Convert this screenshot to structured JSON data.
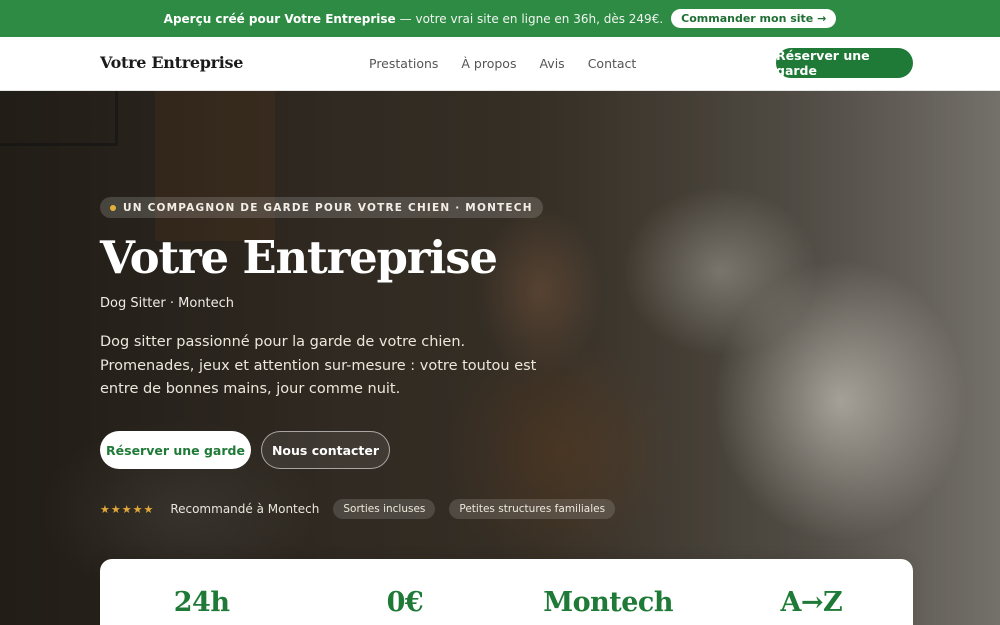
{
  "promo": {
    "lead": "Aperçu créé pour Votre Entreprise",
    "text": "— votre vrai site en ligne en 36h, dès 249€.",
    "button": "Commander mon site →"
  },
  "header": {
    "brand": "Votre Entreprise",
    "nav": [
      "Prestations",
      "À propos",
      "Avis",
      "Contact"
    ],
    "cta": "Réserver une garde"
  },
  "hero": {
    "eyebrow": "UN COMPAGNON DE GARDE POUR VOTRE CHIEN · MONTECH",
    "title": "Votre Entreprise",
    "subtitle": "Dog Sitter · Montech",
    "description": "Dog sitter passionné pour la garde de votre chien. Promenades, jeux et attention sur-mesure : votre toutou est entre de bonnes mains, jour comme nuit.",
    "primary_button": "Réserver une garde",
    "secondary_button": "Nous contacter",
    "rating_stars": "★★★★★",
    "recommendation": "Recommandé à Montech",
    "chips": [
      "Sorties incluses",
      "Petites structures familiales"
    ]
  },
  "stats": [
    "24h",
    "0€",
    "Montech",
    "A→Z"
  ],
  "colors": {
    "brand_green": "#1f7a37",
    "promo_green": "#2e8b43",
    "star_gold": "#e2a93a"
  }
}
